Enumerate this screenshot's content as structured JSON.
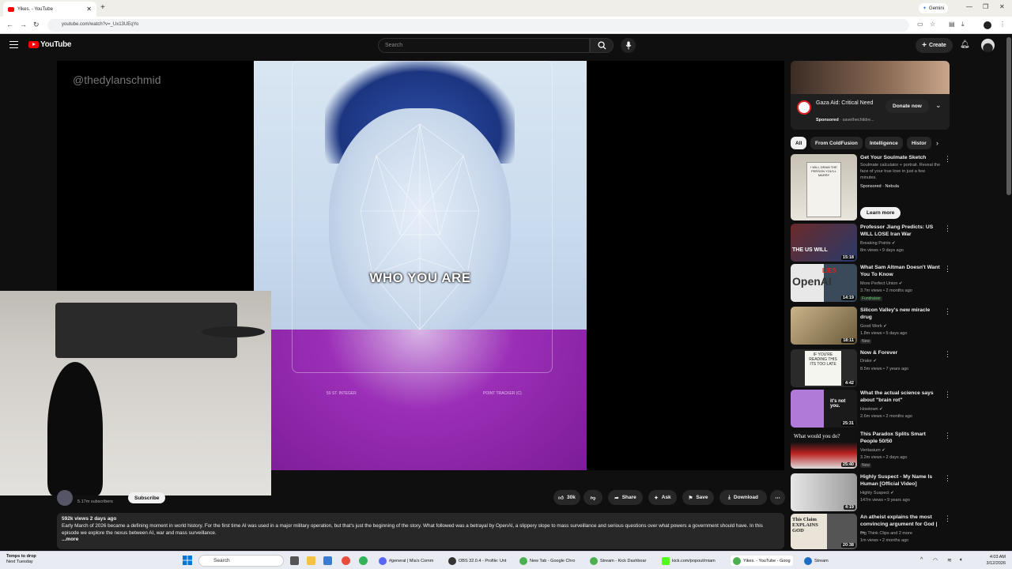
{
  "browser": {
    "tab_title": "Yikes. - YouTube",
    "url": "youtube.com/watch?v=_Ux13UEqYo",
    "gemini_label": "Gemini"
  },
  "youtube": {
    "logo_text": "YouTube",
    "search_placeholder": "Search",
    "create_label": "Create"
  },
  "video": {
    "watermark": "@thedylanschmid",
    "caption": "WHO YOU ARE",
    "hud_left": "50 ST. INTEGER",
    "hud_right": "POINT TRACKER (C)"
  },
  "channel": {
    "subscribers": "5.17m subscribers",
    "subscribe_label": "Subscribe"
  },
  "actions": {
    "like_count": "30k",
    "share": "Share",
    "ask": "Ask",
    "save": "Save",
    "download": "Download"
  },
  "description": {
    "meta": "592k views  2 days ago",
    "text": "Early March of 2026 became a defining moment in world history. For the first time AI was used in a major military operation, but that's just the beginning of the story. What followed was a betrayal by OpenAI, a slippery slope to mass surveillance and serious questions over what powers a government should have. In this episode we explore the nexus between AI, war and mass surveillance.",
    "more": "...more"
  },
  "ad": {
    "title": "Gaza Aid: Critical Need",
    "sponsored": "Sponsored",
    "advertiser": "savethechildre...",
    "donate": "Donate now"
  },
  "chips": [
    "All",
    "From ColdFusion",
    "Intelligence",
    "Histor"
  ],
  "recommendations": [
    {
      "title": "Get Your Soulmate Sketch",
      "line1": "Soulmate calculator + portrait. Reveal the face of your true love in just a few minutes.",
      "line2": "Sponsored · Nebula",
      "cta": "Learn more",
      "duration": ""
    },
    {
      "title": "Professor Jiang Predicts: US WILL LOSE Iran War",
      "line1": "Breaking Points ✔",
      "line2": "8m views • 9 days ago",
      "duration": "15:18",
      "badge": ""
    },
    {
      "title": "What Sam Altman Doesn't Want You To Know",
      "line1": "More Perfect Union ✔",
      "line2": "3.7m views • 2 months ago",
      "duration": "14:19",
      "badge": "Fundraiser"
    },
    {
      "title": "Silicon Valley's new miracle drug",
      "line1": "Good Work ✔",
      "line2": "1.8m views • 5 days ago",
      "duration": "18:11",
      "badge": "New"
    },
    {
      "title": "Now & Forever",
      "line1": "Drake ✔",
      "line2": "8.5m views • 7 years ago",
      "duration": "4:42",
      "badge": ""
    },
    {
      "title": "What the actual science says about \"brain rot\"",
      "line1": "Howtown ✔",
      "line2": "2.6m views • 2 months ago",
      "duration": "25:31",
      "badge": ""
    },
    {
      "title": "This Paradox Splits Smart People 50/50",
      "line1": "Veritasium ✔",
      "line2": "3.2m views • 2 days ago",
      "duration": "25:40",
      "badge": "New"
    },
    {
      "title": "Highly Suspect - My Name Is Human [Official Video]",
      "line1": "Highly Suspect ✔",
      "line2": "147m views • 9 years ago",
      "duration": "4:19",
      "badge": ""
    },
    {
      "title": "An atheist explains the most convincing argument for God | ...",
      "line1": "Big Think Clips and 2 more",
      "line2": "1m views • 2 months ago",
      "duration": "20:38",
      "badge": ""
    }
  ],
  "thumb_text": {
    "t1": "I WILL DRAW THE PERSON YOU'LL MARRY",
    "t2": "THE US WILL",
    "t3": "OpenAI",
    "t3b": "LIES",
    "t5": "IF YOU'RE READING THIS ITS TOO LATE",
    "t6": "it's not you.",
    "t7": "What would you do?",
    "t9": "This Claim EXPLAINS GOD"
  },
  "taskbar": {
    "weather_line1": "Temps to drop",
    "weather_line2": "Next Tuesday",
    "search": "Search",
    "apps": [
      "#general | Mia's Comm",
      "OBS 32.0.4 - Profile: Unt",
      "New Tab - Google Chro",
      "Stream - Kick Dashboar",
      "kick.com/popout/miam",
      "Yikes. - YouTube - Goog",
      "Stream"
    ],
    "time": "4:03 AM",
    "date": "3/12/2026"
  },
  "colors": {
    "bg": "#0f0f0f",
    "yt_red": "#ff0000",
    "sweater": "#9b2fb7"
  }
}
